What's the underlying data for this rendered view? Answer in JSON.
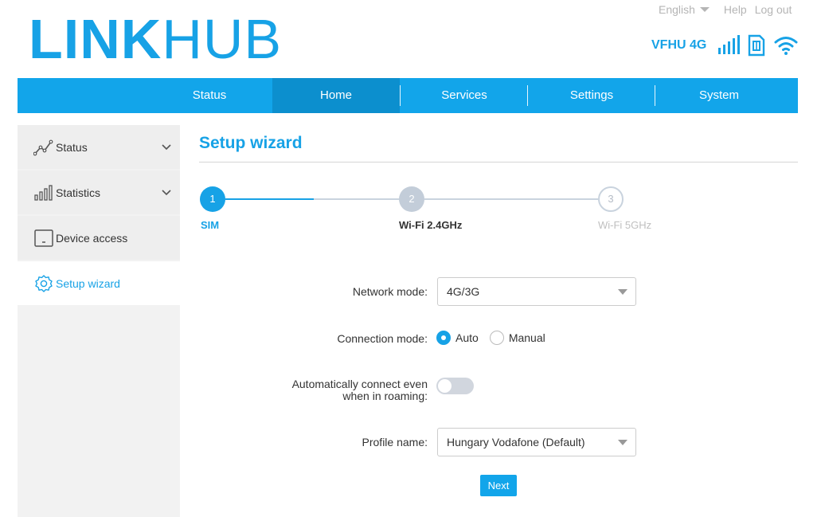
{
  "brand": {
    "logo_bold": "LINK",
    "logo_thin": "HUB",
    "accent": "#17a2e6"
  },
  "toplinks": {
    "language": "English",
    "help": "Help",
    "logout": "Log out"
  },
  "status": {
    "carrier": "VFHU 4G",
    "icons": [
      "signal-bars-icon",
      "sim-card-icon",
      "wifi-icon"
    ]
  },
  "nav": {
    "tabs": [
      "Status",
      "Home",
      "Services",
      "Settings",
      "System"
    ],
    "active": "Home"
  },
  "sidebar": {
    "items": [
      {
        "label": "Status",
        "icon": "line-chart-icon",
        "expandable": true
      },
      {
        "label": "Statistics",
        "icon": "bar-chart-icon",
        "expandable": true
      },
      {
        "label": "Device access",
        "icon": "device-icon",
        "expandable": false
      },
      {
        "label": "Setup wizard",
        "icon": "gear-icon",
        "expandable": false
      }
    ],
    "active": "Setup wizard"
  },
  "main": {
    "title": "Setup wizard",
    "steps": [
      {
        "number": "1",
        "label": "SIM",
        "state": "active"
      },
      {
        "number": "2",
        "label": "Wi-Fi 2.4GHz",
        "state": "pending"
      },
      {
        "number": "3",
        "label": "Wi-Fi 5GHz",
        "state": "disabled"
      }
    ],
    "form": {
      "network_mode_label": "Network mode:",
      "network_mode_value": "4G/3G",
      "connection_mode_label": "Connection mode:",
      "connection_options": [
        "Auto",
        "Manual"
      ],
      "connection_selected": "Auto",
      "roaming_label_line1": "Automatically connect even",
      "roaming_label_line2": "when in roaming:",
      "roaming_enabled": false,
      "profile_label": "Profile name:",
      "profile_value": "Hungary Vodafone (Default)"
    },
    "next_label": "Next"
  }
}
